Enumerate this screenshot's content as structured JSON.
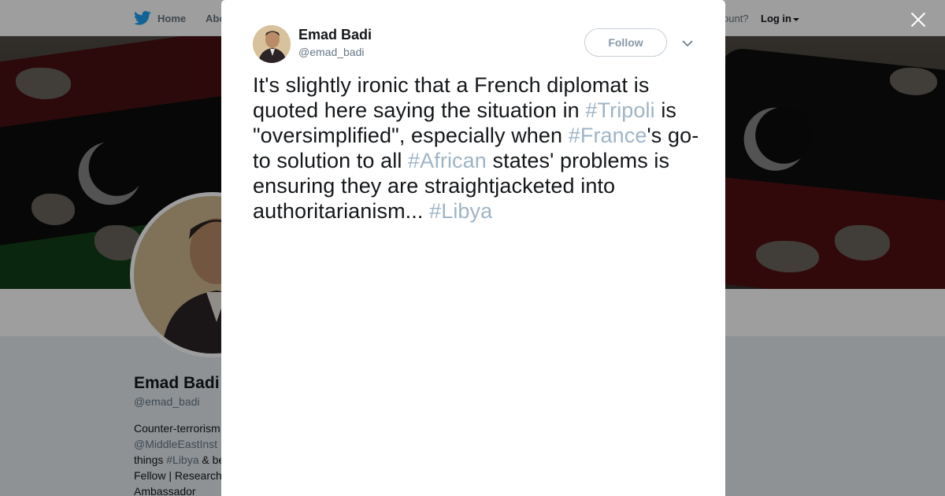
{
  "nav": {
    "home_label": "Home",
    "about_label": "Abo",
    "account_text": "ccount?",
    "login_label": "Log in"
  },
  "profile": {
    "name": "Emad Badi",
    "handle": "@emad_badi",
    "bio_lines": [
      "Counter-terrorism",
      "@MiddleEastInst",
      "things",
      "#Libya",
      "& be",
      "Fellow | Research",
      "Ambassador"
    ]
  },
  "tweet": {
    "author_name": "Emad Badi",
    "author_handle": "@emad_badi",
    "follow_label": "Follow",
    "text_segments": [
      {
        "text": "It's slightly ironic that a French diplomat is quoted here saying the situation in ",
        "hashtag": false
      },
      {
        "text": "#Tripoli",
        "hashtag": true
      },
      {
        "text": " is \"oversimplified\", especially when ",
        "hashtag": false
      },
      {
        "text": "#France",
        "hashtag": true
      },
      {
        "text": "'s go-to solution to all ",
        "hashtag": false
      },
      {
        "text": "#African",
        "hashtag": true
      },
      {
        "text": " states' problems is ensuring they are straightjacketed into authoritarianism... ",
        "hashtag": false
      },
      {
        "text": "#Libya",
        "hashtag": true
      }
    ]
  },
  "icons": {
    "brand": "bird-icon",
    "close": "close-icon",
    "more": "chevron-down-icon"
  },
  "colors": {
    "hashtag": "#9fb4c7",
    "brand": "#1da1f2",
    "text": "#14171a",
    "muted": "#657786"
  }
}
